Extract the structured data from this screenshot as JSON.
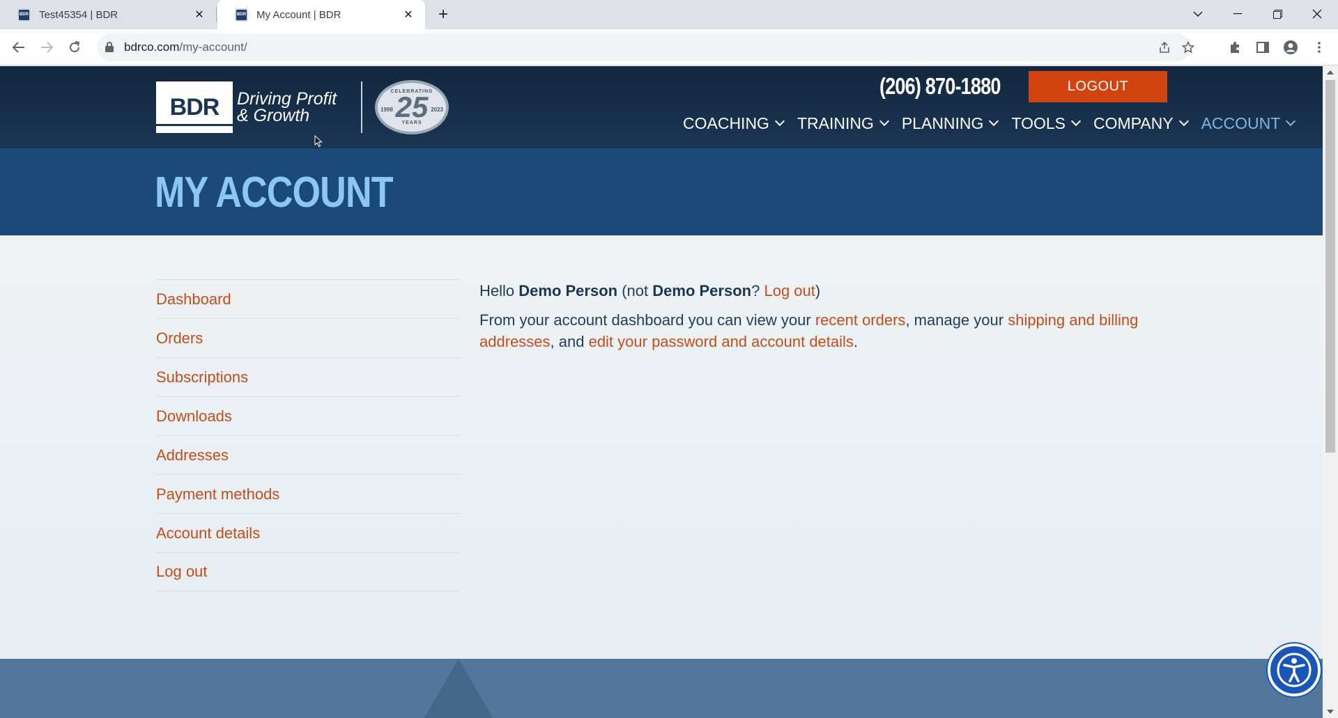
{
  "browser": {
    "tabs": [
      {
        "favicon_text": "BDR",
        "title": "Test45354 | BDR",
        "active": false
      },
      {
        "favicon_text": "BDR",
        "title": "My Account | BDR",
        "active": true
      }
    ],
    "url_host": "bdrco.com",
    "url_path": "/my-account/"
  },
  "site": {
    "logo_text": "BDR",
    "logo_tagline_1": "Driving Profit",
    "logo_tagline_2": "& Growth",
    "seal_top": "CELEBRATING",
    "seal_number": "25",
    "seal_left": "1998",
    "seal_right": "2023",
    "seal_bottom": "YEARS",
    "phone": "(206) 870-1880",
    "logout_label": "LOGOUT",
    "nav": [
      {
        "label": "COACHING"
      },
      {
        "label": "TRAINING"
      },
      {
        "label": "PLANNING"
      },
      {
        "label": "TOOLS"
      },
      {
        "label": "COMPANY"
      },
      {
        "label": "ACCOUNT"
      }
    ]
  },
  "hero": {
    "title": "MY ACCOUNT"
  },
  "account_nav": [
    {
      "label": "Dashboard"
    },
    {
      "label": "Orders"
    },
    {
      "label": "Subscriptions"
    },
    {
      "label": "Downloads"
    },
    {
      "label": "Addresses"
    },
    {
      "label": "Payment methods"
    },
    {
      "label": "Account details"
    },
    {
      "label": "Log out"
    }
  ],
  "dashboard": {
    "hello": "Hello",
    "user_name": "Demo Person",
    "not_prefix": "(not",
    "not_name": "Demo Person",
    "not_suffix": "?",
    "logout_link": "Log out",
    "close_paren": ")",
    "intro": "From your account dashboard you can view your",
    "recent_orders": "recent orders",
    "manage": ", manage your",
    "addresses_link": "shipping and billing addresses",
    "and": ", and",
    "details_link": "edit your password and account details",
    "period": "."
  },
  "colors": {
    "header_bg": "#13273f",
    "hero_bg": "#1c4a78",
    "accent_orange": "#d14410",
    "link_orange": "#c44d1a",
    "active_nav": "#7fb6e6"
  }
}
